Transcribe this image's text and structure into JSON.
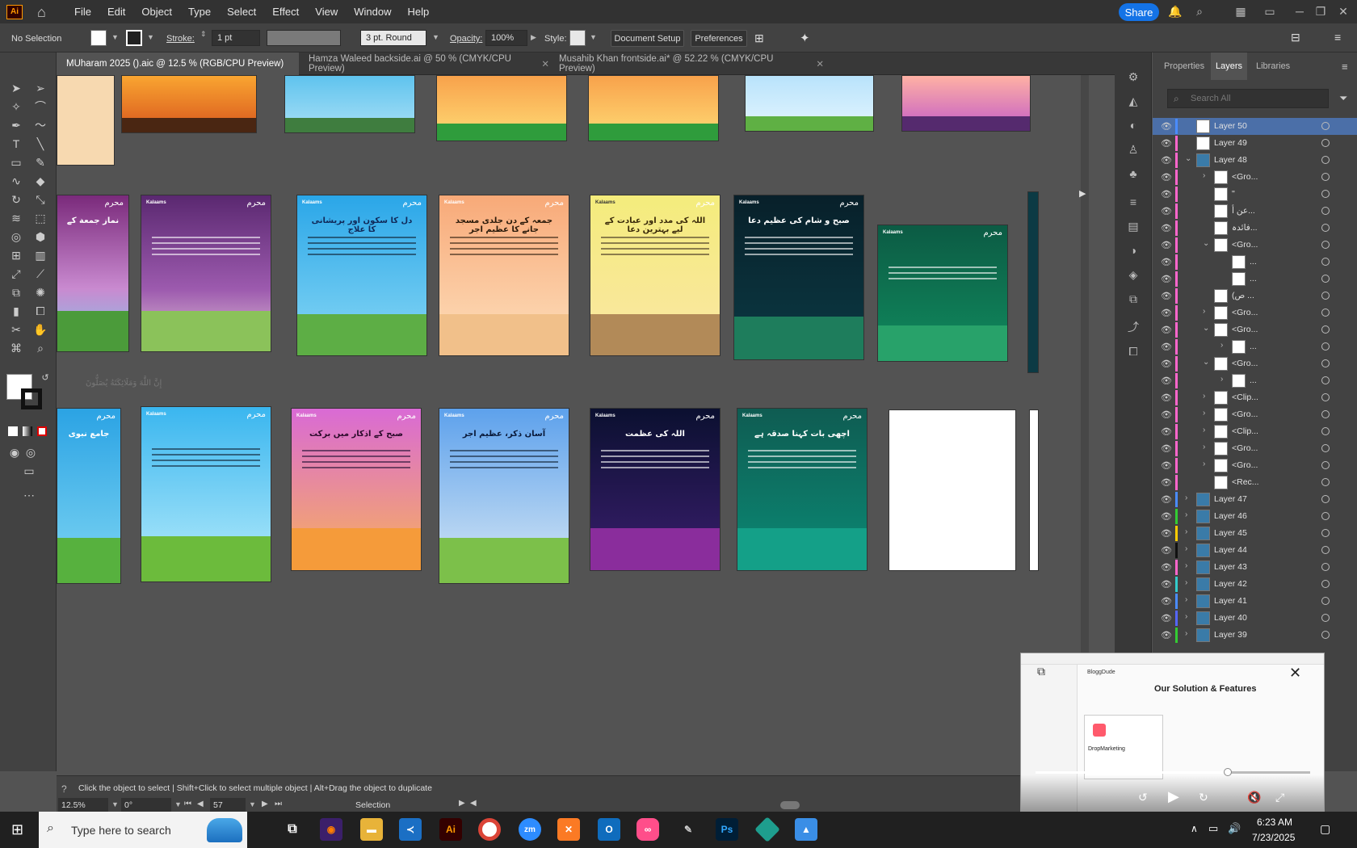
{
  "app": {
    "logo": "Ai",
    "menu": [
      "File",
      "Edit",
      "Object",
      "Type",
      "Select",
      "Effect",
      "View",
      "Window",
      "Help"
    ],
    "share_label": "Share"
  },
  "control": {
    "selection": "No Selection",
    "stroke_label": "Stroke:",
    "stroke_value": "1 pt",
    "brush_value": "3 pt. Round",
    "opacity_label": "Opacity:",
    "opacity_value": "100%",
    "style_label": "Style:",
    "doc_setup": "Document Setup",
    "preferences": "Preferences"
  },
  "tabs": [
    {
      "label": "MUharam 2025 ().aic @ 12.5 % (RGB/CPU Preview)"
    },
    {
      "label": "Hamza Waleed backside.ai @ 50 % (CMYK/CPU Preview)"
    },
    {
      "label": "Musahib Khan  frontside.ai* @ 52.22 % (CMYK/CPU Preview)"
    }
  ],
  "panel": {
    "tabs": [
      "Properties",
      "Layers",
      "Libraries"
    ],
    "search_placeholder": "Search All",
    "layers": [
      {
        "name": "Layer 50",
        "bar": "#4a8cff",
        "indent": 0,
        "expander": "",
        "selected": true
      },
      {
        "name": "Layer 49",
        "bar": "#ff66cc",
        "indent": 0,
        "expander": ""
      },
      {
        "name": "Layer 48",
        "bar": "#ff66cc",
        "indent": 0,
        "expander": "v"
      },
      {
        "name": "<Gro...",
        "bar": "#ff66cc",
        "indent": 1,
        "expander": ">"
      },
      {
        "name": "\"",
        "bar": "#ff66cc",
        "indent": 1,
        "expander": ""
      },
      {
        "name": "عن أ...",
        "bar": "#ff66cc",
        "indent": 1,
        "expander": ""
      },
      {
        "name": "فائدہ...",
        "bar": "#ff66cc",
        "indent": 1,
        "expander": ""
      },
      {
        "name": "<Gro...",
        "bar": "#ff66cc",
        "indent": 1,
        "expander": "v"
      },
      {
        "name": "...",
        "bar": "#ff66cc",
        "indent": 2,
        "expander": ""
      },
      {
        "name": "...",
        "bar": "#ff66cc",
        "indent": 2,
        "expander": ""
      },
      {
        "name": "(ص ...",
        "bar": "#ff66cc",
        "indent": 1,
        "expander": ""
      },
      {
        "name": "<Gro...",
        "bar": "#ff66cc",
        "indent": 1,
        "expander": ">"
      },
      {
        "name": "<Gro...",
        "bar": "#ff66cc",
        "indent": 1,
        "expander": "v"
      },
      {
        "name": "...",
        "bar": "#ff66cc",
        "indent": 2,
        "expander": ">"
      },
      {
        "name": "<Gro...",
        "bar": "#ff66cc",
        "indent": 1,
        "expander": "v"
      },
      {
        "name": "...",
        "bar": "#ff66cc",
        "indent": 2,
        "expander": ">"
      },
      {
        "name": "<Clip...",
        "bar": "#ff66cc",
        "indent": 1,
        "expander": ">"
      },
      {
        "name": "<Gro...",
        "bar": "#ff66cc",
        "indent": 1,
        "expander": ">"
      },
      {
        "name": "<Clip...",
        "bar": "#ff66cc",
        "indent": 1,
        "expander": ">"
      },
      {
        "name": "<Gro...",
        "bar": "#ff66cc",
        "indent": 1,
        "expander": ">"
      },
      {
        "name": "<Gro...",
        "bar": "#ff66cc",
        "indent": 1,
        "expander": ">"
      },
      {
        "name": "<Rec...",
        "bar": "#ff66cc",
        "indent": 1,
        "expander": ""
      },
      {
        "name": "Layer 47",
        "bar": "#4a8cff",
        "indent": 0,
        "expander": ">"
      },
      {
        "name": "Layer 46",
        "bar": "#33cc33",
        "indent": 0,
        "expander": ">"
      },
      {
        "name": "Layer 45",
        "bar": "#ffcc00",
        "indent": 0,
        "expander": ">"
      },
      {
        "name": "Layer 44",
        "bar": "#111111",
        "indent": 0,
        "expander": ">"
      },
      {
        "name": "Layer 43",
        "bar": "#ff66cc",
        "indent": 0,
        "expander": ">"
      },
      {
        "name": "Layer 42",
        "bar": "#33cccc",
        "indent": 0,
        "expander": ">"
      },
      {
        "name": "Layer 41",
        "bar": "#4a8cff",
        "indent": 0,
        "expander": ">"
      },
      {
        "name": "Layer 40",
        "bar": "#5566ff",
        "indent": 0,
        "expander": ">"
      },
      {
        "name": "Layer 39",
        "bar": "#33cc33",
        "indent": 0,
        "expander": ">"
      }
    ]
  },
  "artboards": {
    "brand": "Kalaams",
    "sigil": "محرم",
    "row2_titles": [
      "نماز جمعة کے",
      "",
      "دل کا سکون اور پریشانی کا علاج",
      "جمعہ کے دن جلدی مسجد جانے کا عظیم اجر",
      "اللہ کی مدد اور عبادت کے لیے بہترین دعا",
      "صبح و شام کی عظیم دعا",
      "",
      ""
    ],
    "row3_titles": [
      "جامع نبوی",
      "",
      "صبح کے اذکار میں برکت",
      "آسان ذکر، عظیم اجر",
      "اللہ کی عظمت",
      "اچھی بات کہنا صدقہ ہے",
      ""
    ],
    "side_text": "إِنَّ اللَّهَ وَمَلَائِكَتَهُ يُصَلُّونَ"
  },
  "status": {
    "hint": "Click the object to select  |  Shift+Click to select multiple object  |  Alt+Drag the object to duplicate",
    "zoom": "12.5%",
    "rotation": "0°",
    "artboard": "57",
    "mode": "Selection"
  },
  "video": {
    "brand": "BloggDude",
    "heading": "Our Solution & Features",
    "card_title": "DropMarketing"
  },
  "taskbar": {
    "search_placeholder": "Type here to search",
    "time": "6:23 AM",
    "date": "7/23/2025"
  }
}
